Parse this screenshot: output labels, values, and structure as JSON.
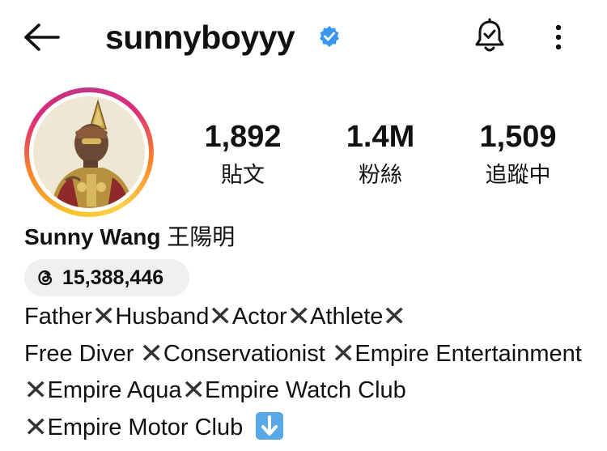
{
  "header": {
    "username": "sunnyboyyy",
    "verified": true,
    "icons": [
      "back-arrow-icon",
      "verified-badge-icon",
      "notification-bell-icon",
      "more-options-icon"
    ]
  },
  "profile": {
    "stats": [
      {
        "value": "1,892",
        "label": "貼文"
      },
      {
        "value": "1.4M",
        "label": "粉絲"
      },
      {
        "value": "1,509",
        "label": "追蹤中"
      }
    ],
    "full_name_latin": "Sunny Wang",
    "full_name_chinese": "王陽明",
    "threads_count": "15,388,446",
    "bio_parts": [
      "Father",
      "Husband",
      "Actor",
      "Athlete",
      "Free Diver ",
      "Conservationist ",
      "Empire Entertainment",
      "Empire Aqua",
      "Empire Watch Club",
      "Empire Motor Club "
    ],
    "bio_emoji": [
      "cross-mark-emoji",
      "down-arrow-emoji"
    ]
  },
  "colors": {
    "verified_blue": "#3897f0",
    "story_ring": [
      "#f9c02a",
      "#f58529",
      "#dd2a7b",
      "#c13584"
    ],
    "threads_pill_bg": "#efefef",
    "arrow_emoji_bg": "#58a8e8"
  }
}
